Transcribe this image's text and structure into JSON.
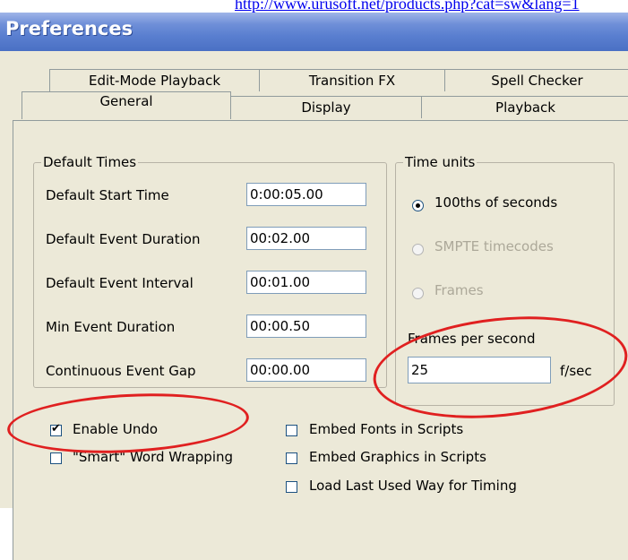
{
  "link_text": "http://www.urusoft.net/products.php?cat=sw&lang=1",
  "window": {
    "title": "Preferences"
  },
  "tabs_back": [
    {
      "label": "Edit-Mode Playback"
    },
    {
      "label": "Transition FX"
    },
    {
      "label": "Spell Checker"
    }
  ],
  "tabs_front": [
    {
      "label": "General",
      "active": true
    },
    {
      "label": "Display"
    },
    {
      "label": "Playback"
    }
  ],
  "default_times": {
    "legend": "Default Times",
    "rows": [
      {
        "label": "Default Start Time",
        "value": "0:00:05.00"
      },
      {
        "label": "Default Event Duration",
        "value": "00:02.00"
      },
      {
        "label": "Default Event Interval",
        "value": "00:01.00"
      },
      {
        "label": "Min Event Duration",
        "value": "00:00.50"
      },
      {
        "label": "Continuous Event Gap",
        "value": "00:00.00"
      }
    ]
  },
  "time_units": {
    "legend": "Time units",
    "options": [
      {
        "label": "100ths of seconds",
        "selected": true,
        "enabled": true
      },
      {
        "label": "SMPTE timecodes",
        "selected": false,
        "enabled": false
      },
      {
        "label": "Frames",
        "selected": false,
        "enabled": false
      }
    ],
    "fps_label": "Frames per second",
    "fps_value": "25",
    "fps_unit": "f/sec"
  },
  "checkboxes": [
    {
      "label": "Enable Undo",
      "checked": true
    },
    {
      "label": "\"Smart\" Word Wrapping",
      "checked": false
    },
    {
      "label": "Embed Fonts in Scripts",
      "checked": false
    },
    {
      "label": "Embed Graphics in Scripts",
      "checked": false
    },
    {
      "label": "Load Last Used Way for Timing",
      "checked": false
    }
  ],
  "colors": {
    "highlight_circle": "#e02020",
    "titlebar": "#5a7fd0"
  }
}
